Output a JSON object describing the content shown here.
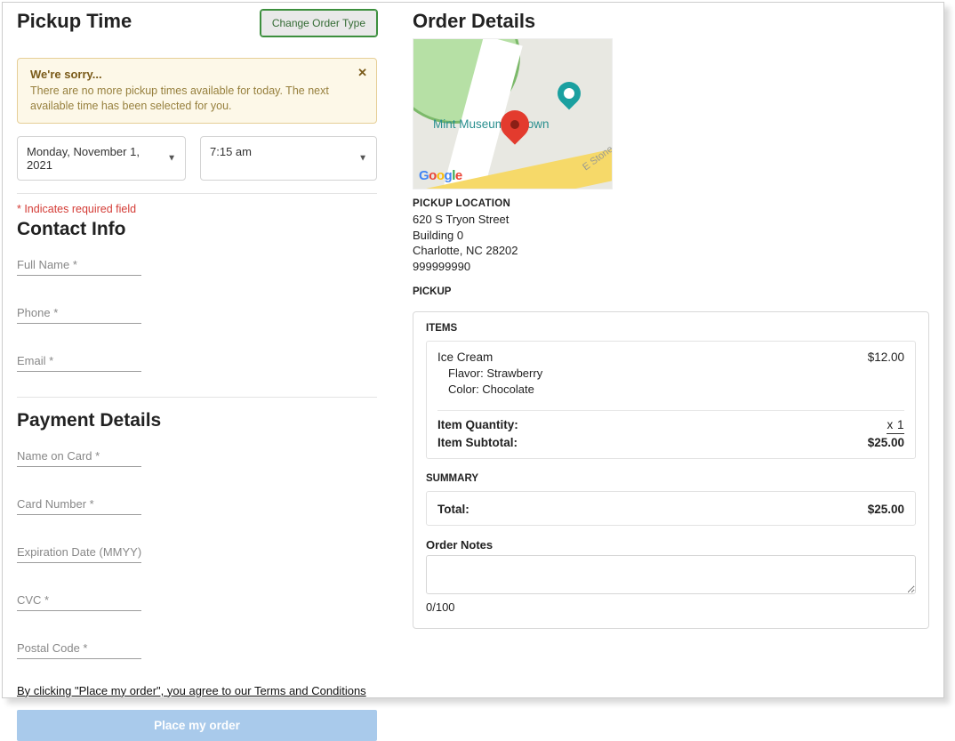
{
  "left": {
    "pickup_time_title": "Pickup Time",
    "change_order_label": "Change Order Type",
    "alert_title": "We're sorry...",
    "alert_msg": "There are no more pickup times available for today. The next available time has been selected for you.",
    "date_value": "Monday, November 1, 2021",
    "time_value": "7:15 am",
    "required_note": "* Indicates required field",
    "contact_title": "Contact Info",
    "full_name_ph": "Full Name *",
    "phone_ph": "Phone *",
    "email_ph": "Email *",
    "payment_title": "Payment Details",
    "name_card_ph": "Name on Card *",
    "card_num_ph": "Card Number *",
    "exp_ph": "Expiration Date (MMYY) *",
    "cvc_ph": "CVC *",
    "postal_ph": "Postal Code *",
    "tc_text": "By clicking \"Place my order\", you agree to our Terms and Conditions",
    "place_order_label": "Place my order"
  },
  "right": {
    "order_details_title": "Order Details",
    "map_label_text": "Mint Museum Uptown",
    "map_street_text": "E Stone",
    "pickup_loc_head": "PICKUP LOCATION",
    "addr1": "620 S Tryon Street",
    "addr2": "Building 0",
    "addr3": "Charlotte, NC 28202",
    "addr4": "999999990",
    "pickup_label": "PICKUP",
    "items_label": "ITEMS",
    "item_name": "Ice Cream",
    "item_price": "$12.00",
    "opt1": "Flavor: Strawberry",
    "opt2": "Color: Chocolate",
    "qty_label": "Item Quantity:",
    "qty_val": "x  1",
    "subtotal_label": "Item Subtotal:",
    "subtotal_val": "$25.00",
    "summary_label": "SUMMARY",
    "total_label": "Total:",
    "total_val": "$25.00",
    "notes_label": "Order Notes",
    "counter": "0/100"
  }
}
